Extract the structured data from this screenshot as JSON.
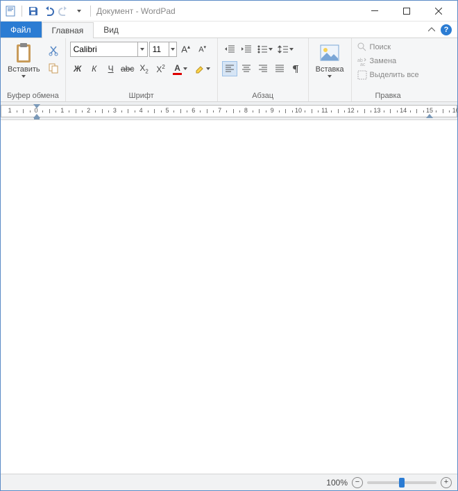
{
  "window": {
    "title": "Документ - WordPad"
  },
  "tabs": {
    "file": "Файл",
    "home": "Главная",
    "view": "Вид"
  },
  "clipboard": {
    "paste": "Вставить",
    "group": "Буфер обмена"
  },
  "font": {
    "group": "Шрифт",
    "family": "Calibri",
    "size": "11"
  },
  "paragraph": {
    "group": "Абзац"
  },
  "insert": {
    "label": "Вставка"
  },
  "editing": {
    "group": "Правка",
    "find": "Поиск",
    "replace": "Замена",
    "selectall": "Выделить все"
  },
  "status": {
    "zoom": "100%"
  }
}
